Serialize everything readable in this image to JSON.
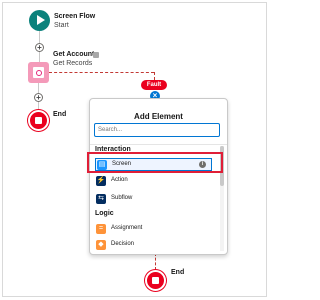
{
  "canvas": {
    "start": {
      "title": "Screen Flow",
      "subtitle": "Start",
      "icon": "play-icon"
    },
    "get_records": {
      "title": "Get Accounts",
      "subtitle": "Get Records",
      "icon": "get-records-icon"
    },
    "end_label": "End",
    "fault_label": "Fault",
    "close_glyph": "×"
  },
  "add_element": {
    "title": "Add Element",
    "search_placeholder": "Search...",
    "sections": [
      {
        "header": "Interaction",
        "items": [
          {
            "label": "Screen",
            "icon": "screen-icon",
            "color": "#1b96ff",
            "selected": true
          },
          {
            "label": "Action",
            "icon": "action-icon",
            "color": "#032d60"
          },
          {
            "label": "Subflow",
            "icon": "subflow-icon",
            "color": "#032d60"
          }
        ]
      },
      {
        "header": "Logic",
        "items": [
          {
            "label": "Assignment",
            "icon": "assignment-icon",
            "color": "#fe9339"
          },
          {
            "label": "Decision",
            "icon": "decision-icon",
            "color": "#fe9339"
          }
        ]
      }
    ]
  },
  "colors": {
    "accent": "#0176d3",
    "fault": "#ea001e",
    "start": "#0b827c",
    "get_records": "#f49ab9"
  }
}
